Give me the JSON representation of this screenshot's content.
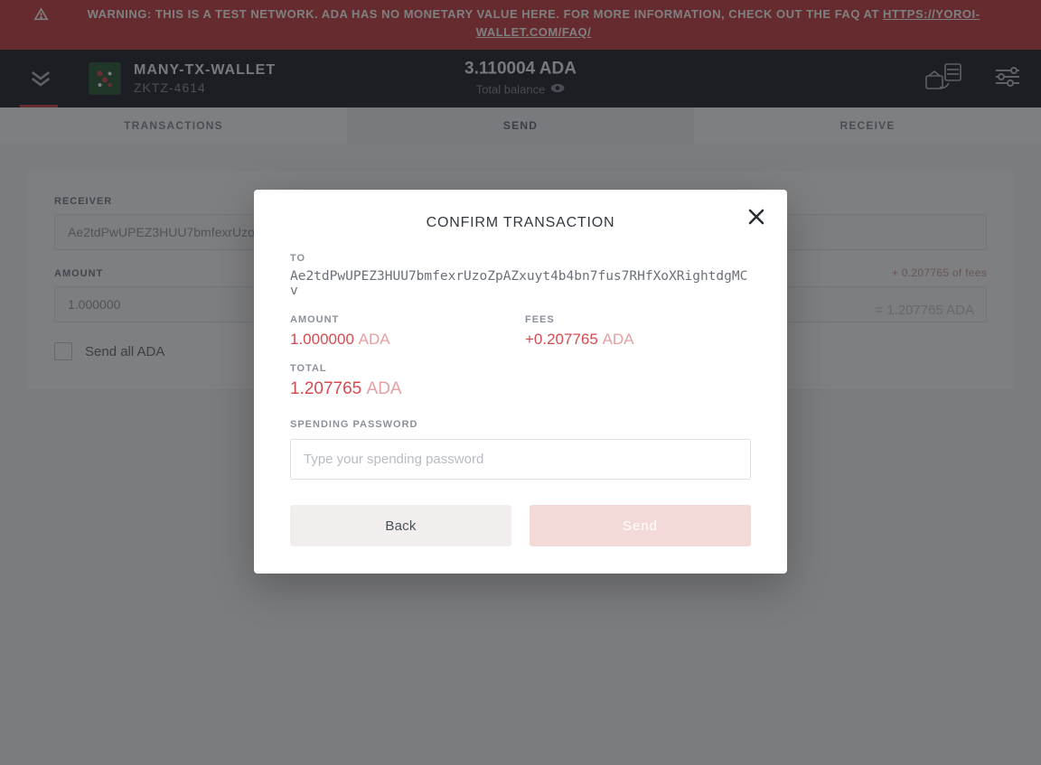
{
  "warning": {
    "prefix": "WARNING: THIS IS A TEST NETWORK. ADA HAS NO MONETARY VALUE HERE. FOR MORE INFORMATION, CHECK OUT THE FAQ AT ",
    "link": "HTTPS://YOROI-WALLET.COM/FAQ/"
  },
  "header": {
    "wallet_name": "MANY-TX-WALLET",
    "wallet_code": "ZKTZ-4614",
    "balance": "3.110004 ADA",
    "balance_label": "Total balance"
  },
  "tabs": {
    "transactions": "TRANSACTIONS",
    "send": "SEND",
    "receive": "RECEIVE"
  },
  "form": {
    "receiver_label": "RECEIVER",
    "receiver_value": "Ae2tdPwUPEZ3HUU7bmfexrUzo",
    "amount_label": "AMOUNT",
    "amount_value": "1.000000",
    "fee_hint": "+ 0.207765 of fees",
    "eq_hint": "= 1.207765 ADA",
    "send_all": "Send all ADA"
  },
  "modal": {
    "title": "CONFIRM TRANSACTION",
    "to_label": "TO",
    "to_value": "Ae2tdPwUPEZ3HUU7bmfexrUzoZpAZxuyt4b4bn7fus7RHfXoXRightdgMCv",
    "amount_label": "AMOUNT",
    "amount_value": "1.000000",
    "fees_label": "FEES",
    "fees_value": "+0.207765",
    "total_label": "TOTAL",
    "total_value": "1.207765",
    "currency": "ADA",
    "pw_label": "SPENDING PASSWORD",
    "pw_placeholder": "Type your spending password",
    "back": "Back",
    "send": "Send"
  }
}
